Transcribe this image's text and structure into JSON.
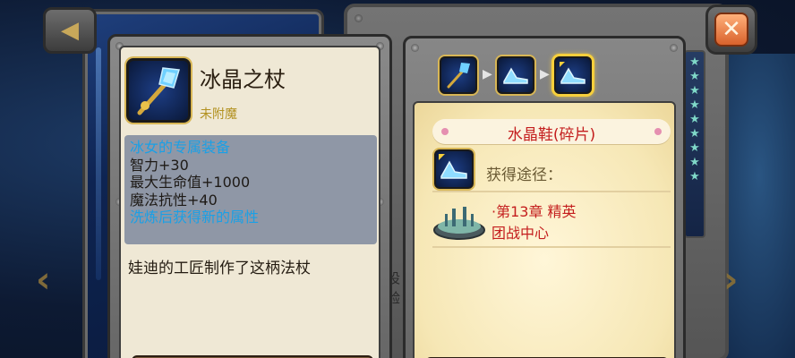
{
  "item": {
    "name": "冰晶之杖",
    "enchant": "未附魔",
    "icon": "crystal-staff-icon",
    "stats": [
      {
        "text": "冰女的专属装备",
        "color": "#1aa0e6"
      },
      {
        "text": "智力+30",
        "color": "#1e1a16"
      },
      {
        "text": "最大生命值+1000",
        "color": "#1e1a16"
      },
      {
        "text": "魔法抗性+40",
        "color": "#1e1a16"
      },
      {
        "text": "洗炼后获得新的属性",
        "color": "#1aa0e6"
      }
    ],
    "flavor": "娃迪的工匠制作了这柄法杖"
  },
  "source": {
    "breadcrumb": [
      "crystal-staff-icon",
      "crystal-shoe-icon",
      "crystal-shoe-fragment-icon"
    ],
    "fragment_title": "水晶鞋(碎片)",
    "acquire_label": "获得途径：",
    "entries": [
      {
        "line1": "·第13章  精英",
        "line2": "团战中心",
        "icon": "battle-arena-icon"
      }
    ]
  },
  "peek_text": "设\n验",
  "colors": {
    "title_red": "#c41e1e",
    "stat_blue": "#1aa0e6",
    "enchant_gold": "#b29120",
    "close_orange": "#d9622c"
  }
}
